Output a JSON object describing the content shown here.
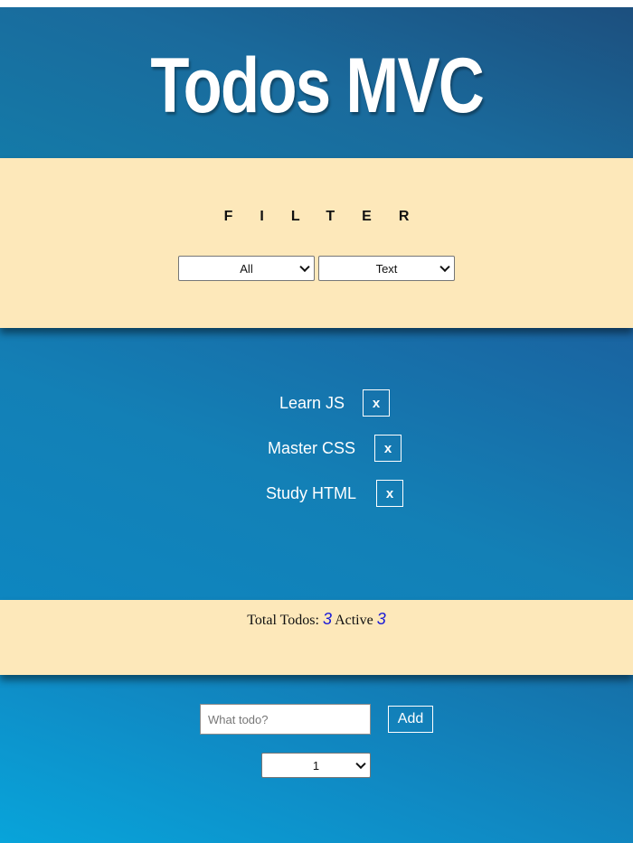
{
  "header": {
    "title": "Todos MVC"
  },
  "filter": {
    "heading": "FILTER",
    "status_select": {
      "selected": "All"
    },
    "sort_select": {
      "selected": "Text"
    }
  },
  "todos": [
    {
      "text": "Learn JS",
      "delete_label": "x"
    },
    {
      "text": "Master CSS",
      "delete_label": "x"
    },
    {
      "text": "Study HTML",
      "delete_label": "x"
    }
  ],
  "stats": {
    "total_label": "Total Todos:",
    "total_value": "3",
    "active_label": "Active",
    "active_value": "3"
  },
  "add_form": {
    "input_placeholder": "What todo?",
    "input_value": "",
    "add_label": "Add",
    "priority_select": {
      "selected": "1"
    }
  },
  "colors": {
    "accent_panel": "#fde8ba",
    "stats_number": "#1a1ad6",
    "header_blue": "#1c4f7e"
  }
}
